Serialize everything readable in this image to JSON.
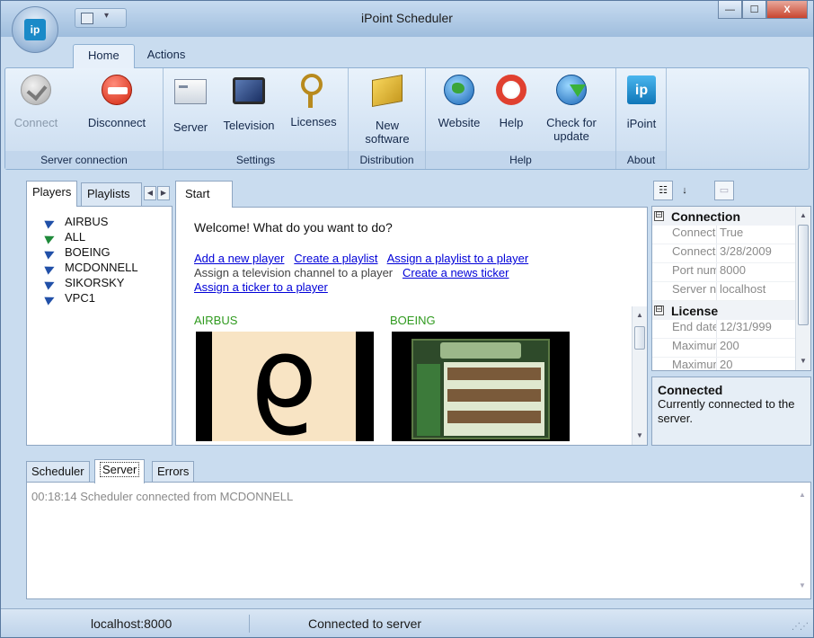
{
  "window": {
    "title": "iPoint Scheduler",
    "orb_label": "ip",
    "buttons": {
      "minimize": "—",
      "maximize": "☐",
      "close": "X"
    }
  },
  "ribbon": {
    "tabs": [
      {
        "label": "Home",
        "active": true
      },
      {
        "label": "Actions",
        "active": false
      }
    ],
    "groups": {
      "server_connection": {
        "label": "Server connection",
        "connect": "Connect",
        "disconnect": "Disconnect"
      },
      "settings": {
        "label": "Settings",
        "server": "Server",
        "television": "Television",
        "licenses": "Licenses"
      },
      "distribution": {
        "label": "Distribution",
        "new_software_line1": "New",
        "new_software_line2": "software"
      },
      "help": {
        "label": "Help",
        "website": "Website",
        "help": "Help",
        "check_line1": "Check for",
        "check_line2": "update"
      },
      "about": {
        "label": "About",
        "ipoint": "iPoint",
        "icon_text": "ip"
      }
    }
  },
  "left_panel": {
    "tabs": [
      "Players",
      "Playlists"
    ],
    "players": [
      "AIRBUS",
      "ALL",
      "BOEING",
      "MCDONNELL",
      "SIKORSKY",
      "VPC1"
    ]
  },
  "center_panel": {
    "tab": "Start",
    "welcome": "Welcome! What do you want to do?",
    "links": {
      "add_player": "Add a new player",
      "create_playlist": "Create a playlist",
      "assign_playlist": "Assign a playlist to a player",
      "assign_tv": "Assign a television channel to a player",
      "create_ticker": "Create a news ticker",
      "assign_ticker": "Assign a ticker to a player"
    },
    "thumbnails": [
      {
        "label": "AIRBUS",
        "digit": "6"
      },
      {
        "label": "BOEING"
      }
    ]
  },
  "properties": {
    "categories": [
      {
        "name": "Connection",
        "toggle": "⊟",
        "rows": [
          {
            "name": "Connecte",
            "value": "True"
          },
          {
            "name": "Connecte",
            "value": "3/28/2009"
          },
          {
            "name": "Port num",
            "value": "8000"
          },
          {
            "name": "Server n",
            "value": "localhost"
          }
        ]
      },
      {
        "name": "License",
        "toggle": "⊟",
        "rows": [
          {
            "name": "End date",
            "value": "12/31/999"
          },
          {
            "name": "Maximum",
            "value": "200"
          },
          {
            "name": "Maximum",
            "value": "20"
          }
        ]
      }
    ],
    "description": {
      "title": "Connected",
      "text": "Currently connected to the server."
    }
  },
  "bottom_panel": {
    "tabs": [
      "Scheduler",
      "Server",
      "Errors"
    ],
    "active_tab": "Server",
    "log": [
      "00:18:14  Scheduler connected from MCDONNELL"
    ]
  },
  "statusbar": {
    "server": "localhost:8000",
    "status": "Connected to server"
  }
}
